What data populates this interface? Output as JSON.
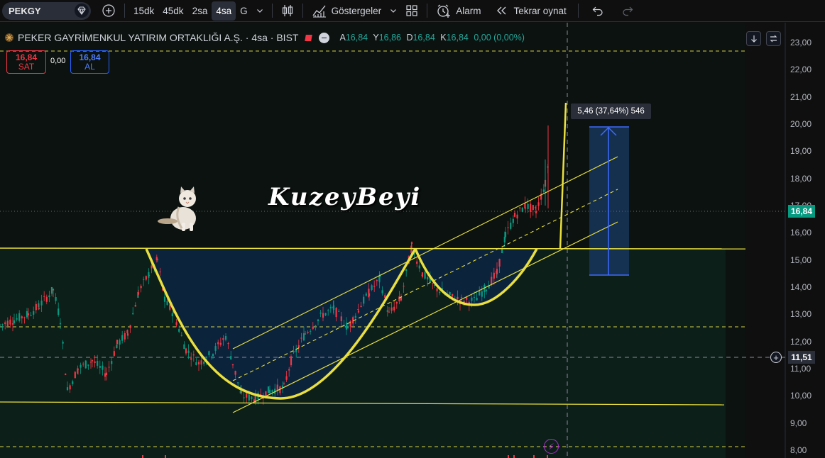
{
  "toolbar": {
    "symbol": "PEKGY",
    "intervals": [
      "15dk",
      "45dk",
      "2sa",
      "4sa",
      "G"
    ],
    "active_interval": "4sa",
    "indicators_label": "Göstergeler",
    "alarm_label": "Alarm",
    "replay_label": "Tekrar oynat"
  },
  "legend": {
    "title": "PEKER GAYRİMENKUL YATIRIM ORTAKLIĞI A.Ş. · 4sa · BIST",
    "ohlc": [
      {
        "k": "A",
        "v": "16,84"
      },
      {
        "k": "Y",
        "v": "16,86"
      },
      {
        "k": "D",
        "v": "16,84"
      },
      {
        "k": "K",
        "v": "16,84"
      }
    ],
    "change": "0,00 (0,00%)"
  },
  "trade": {
    "sell_price": "16,84",
    "sell_label": "SAT",
    "spread": "0,00",
    "buy_price": "16,84",
    "buy_label": "AL"
  },
  "measure_tooltip": "5,46 (37,64%) 546",
  "watermark": "KuzeyBeyi",
  "price_axis": {
    "ticks": [
      "23,00",
      "22,00",
      "21,00",
      "20,00",
      "19,00",
      "18,00",
      "17,00",
      "16,00",
      "15,00",
      "14,00",
      "13,00",
      "12,00",
      "11,00",
      "10,00",
      "9,00",
      "8,00"
    ],
    "current_price": "16,84",
    "crosshair_price": "11,51"
  },
  "colors": {
    "up": "#089981",
    "down": "#f23645",
    "drawing": "#f0e44a",
    "measure": "#2962ff"
  },
  "icons": [
    "diamond-icon",
    "add-symbol-icon",
    "chevron-down-icon",
    "candles-icon",
    "indicators-icon",
    "templates-icon",
    "alarm-icon",
    "replay-icon",
    "undo-icon",
    "redo-icon",
    "scroll-down-icon",
    "reset-icon",
    "flash-icon",
    "cat-sticker"
  ]
}
